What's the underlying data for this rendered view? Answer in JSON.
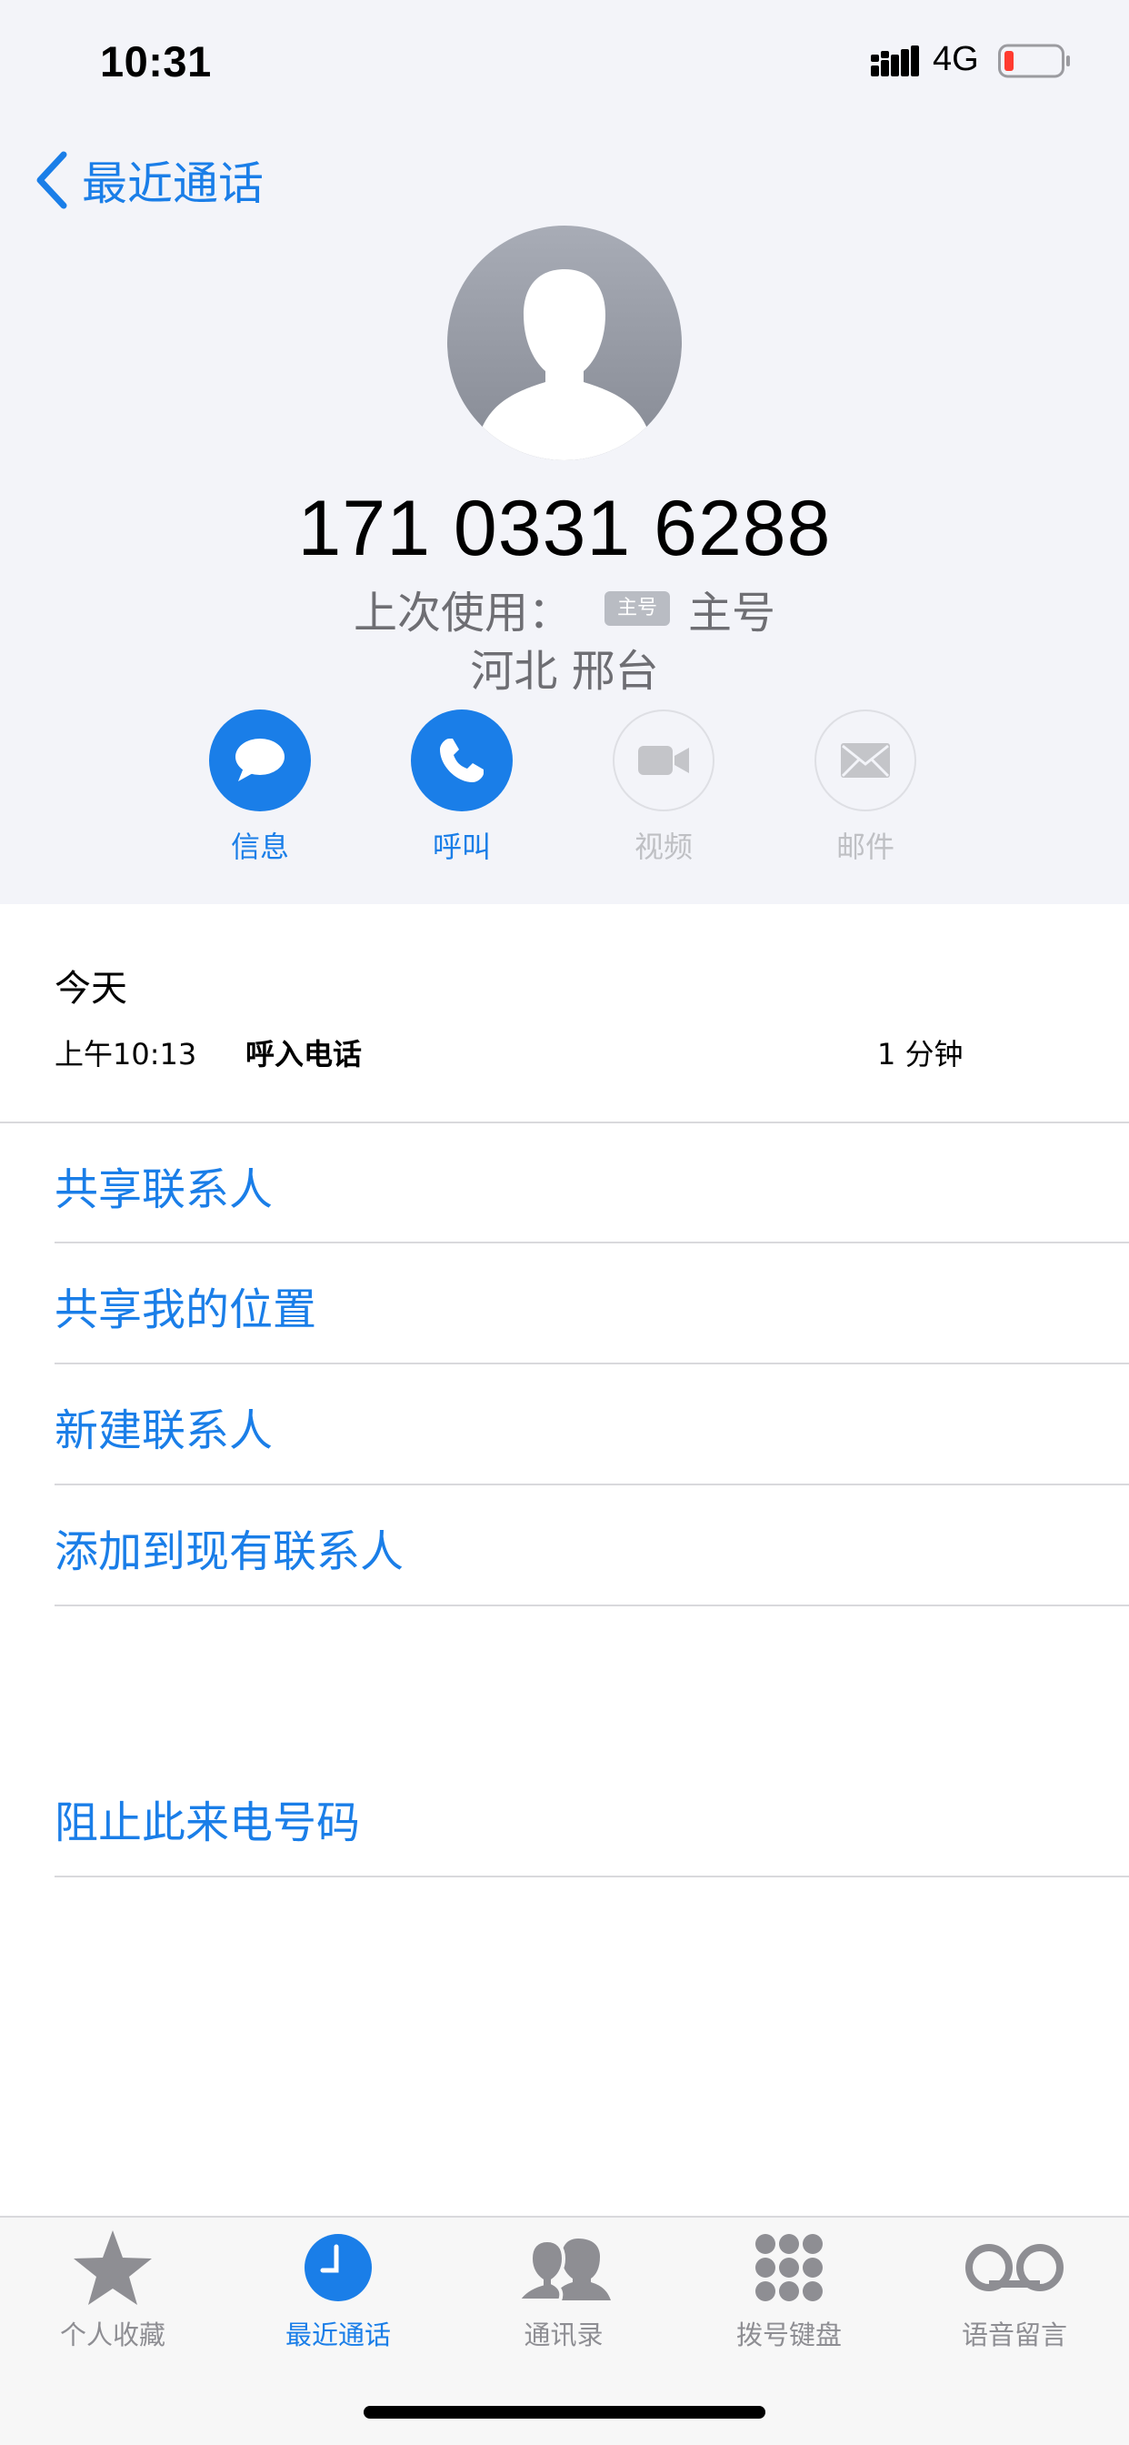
{
  "status_bar": {
    "time": "10:31",
    "network": "4G",
    "signal_icon": "cellular-signal-icon",
    "battery_icon": "battery-low-icon",
    "battery_color": "#ff3b30"
  },
  "nav": {
    "back_label": "最近通话",
    "back_icon": "chevron-left-icon"
  },
  "contact": {
    "avatar_icon": "person-silhouette-icon",
    "phone_number": "171 0331 6288",
    "last_used_prefix": "上次使用：",
    "line_badge": "主号",
    "line_name": "主号",
    "location": "河北 邢台"
  },
  "actions": [
    {
      "label": "信息",
      "icon": "message-bubble-icon",
      "enabled": true
    },
    {
      "label": "呼叫",
      "icon": "phone-icon",
      "enabled": true
    },
    {
      "label": "视频",
      "icon": "video-camera-icon",
      "enabled": false
    },
    {
      "label": "邮件",
      "icon": "envelope-icon",
      "enabled": false
    }
  ],
  "history": {
    "date": "今天",
    "entries": [
      {
        "time": "上午10:13",
        "type": "呼入电话",
        "duration": "1 分钟"
      }
    ]
  },
  "options": [
    {
      "label": "共享联系人"
    },
    {
      "label": "共享我的位置"
    },
    {
      "label": "新建联系人"
    },
    {
      "label": "添加到现有联系人"
    }
  ],
  "block_option": {
    "label": "阻止此来电号码"
  },
  "tabs": [
    {
      "label": "个人收藏",
      "icon": "star-icon",
      "selected": false
    },
    {
      "label": "最近通话",
      "icon": "clock-icon",
      "selected": true
    },
    {
      "label": "通讯录",
      "icon": "contacts-icon",
      "selected": false
    },
    {
      "label": "拨号键盘",
      "icon": "keypad-icon",
      "selected": false
    },
    {
      "label": "语音留言",
      "icon": "voicemail-icon",
      "selected": false
    }
  ],
  "colors": {
    "accent": "#1a7ee8",
    "header_bg": "#f3f4f9",
    "secondary_text": "#6e6e73",
    "disabled": "#bfc0c4"
  }
}
